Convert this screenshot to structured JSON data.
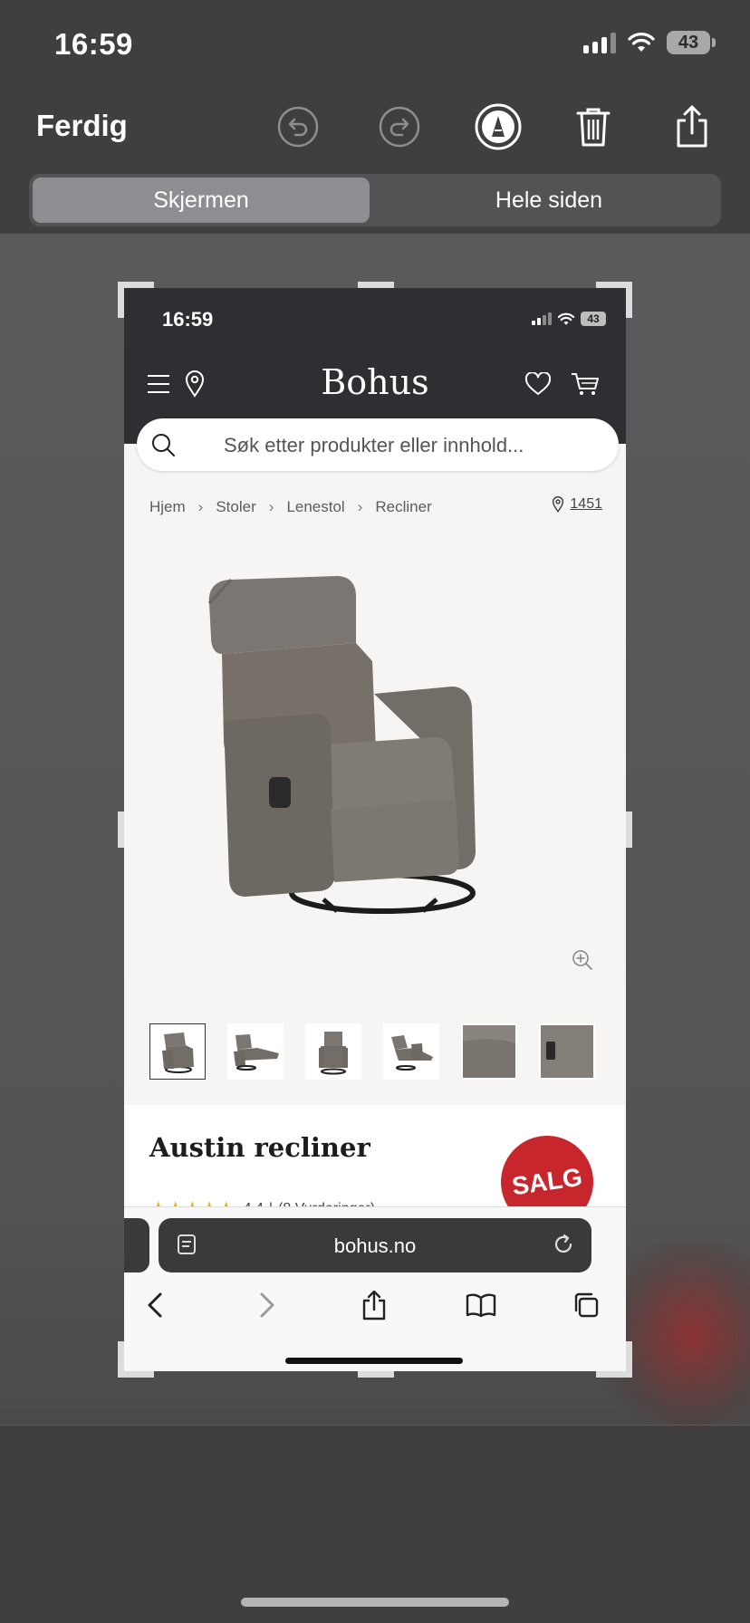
{
  "status_bar": {
    "time": "16:59",
    "battery": "43"
  },
  "toolbar": {
    "done_label": "Ferdig",
    "icons": [
      "undo-icon",
      "redo-icon",
      "markup-icon",
      "trash-icon",
      "share-icon"
    ]
  },
  "segment": {
    "screen_label": "Skjermen",
    "full_page_label": "Hele siden",
    "selected": "Skjermen"
  },
  "screenshot": {
    "status": {
      "time": "16:59",
      "battery": "43"
    },
    "header": {
      "brand": "Bohus"
    },
    "search": {
      "placeholder": "Søk etter produkter eller innhold..."
    },
    "breadcrumb": [
      "Hjem",
      "Stoler",
      "Lenestol",
      "Recliner"
    ],
    "store_number": "1451",
    "thumbnails_count": 6,
    "product": {
      "name": "Austin recliner",
      "badge": "SALG",
      "rating": "4.4",
      "rating_count": "(8 Vurderinger)",
      "stars": "★★★★★"
    },
    "safari": {
      "url": "bohus.no"
    }
  },
  "colors": {
    "badge": "#c8262d",
    "header": "#2f2f33",
    "stars": "#f5b301"
  }
}
